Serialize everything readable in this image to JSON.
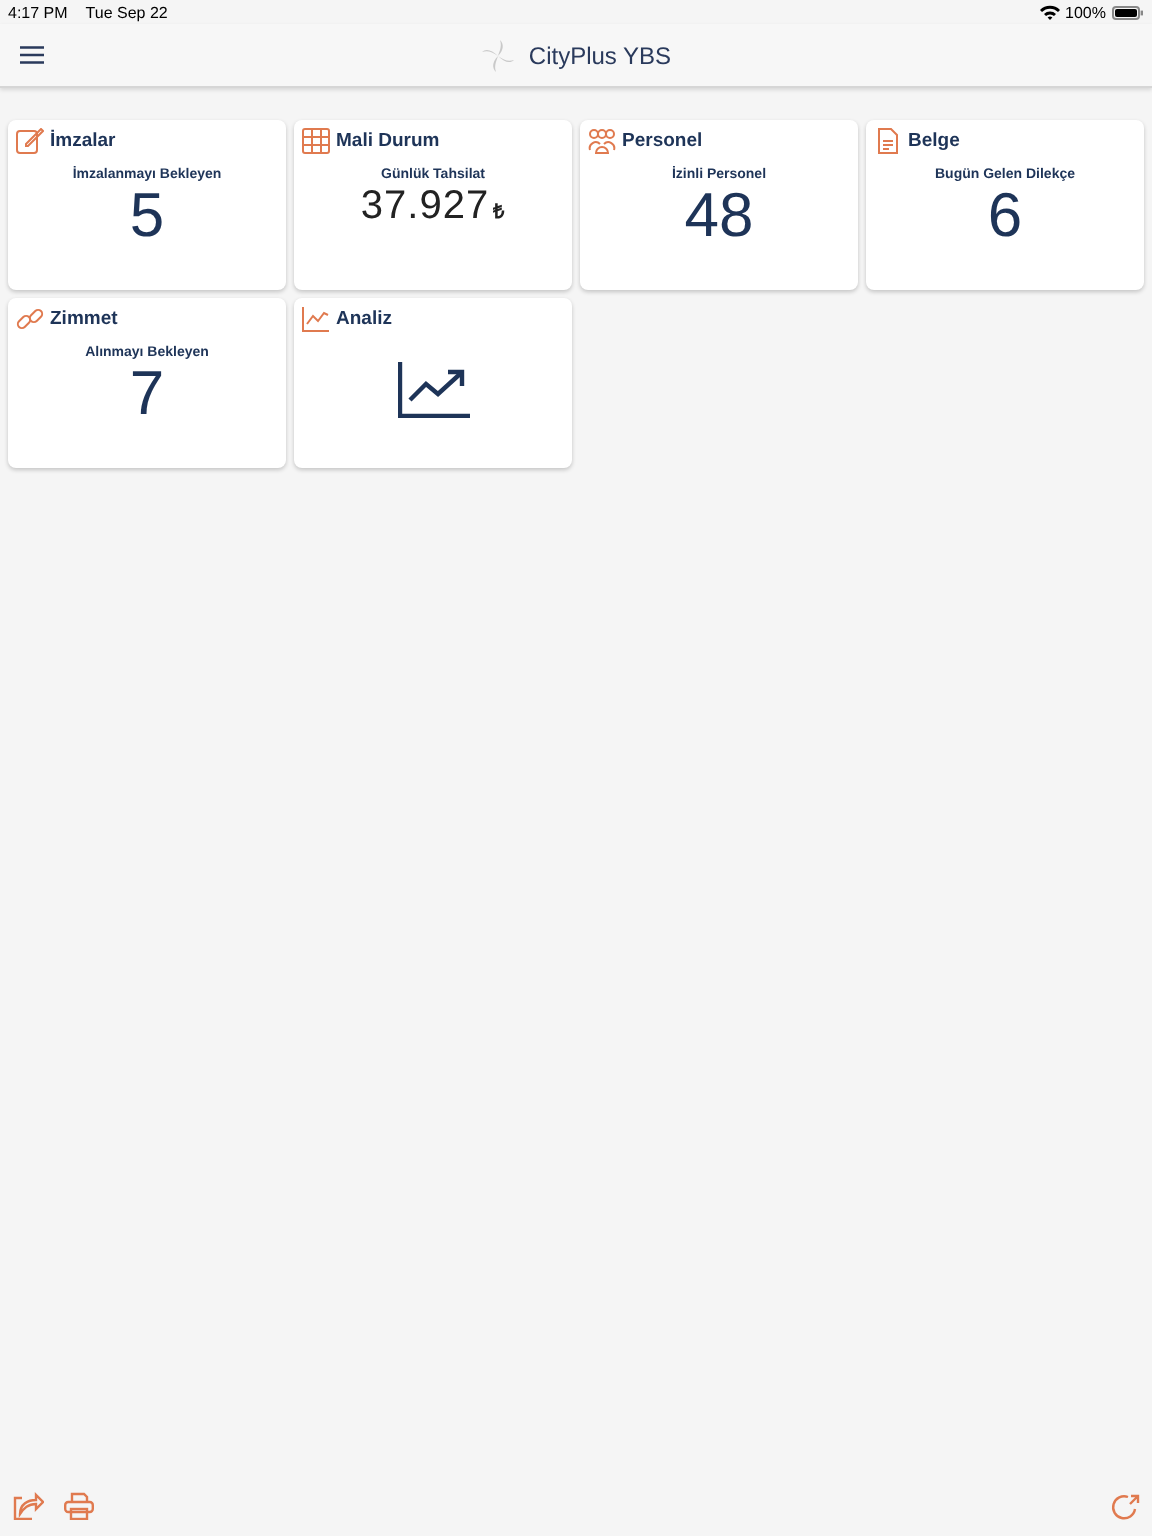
{
  "status_bar": {
    "time": "4:17 PM",
    "date": "Tue Sep 22",
    "battery": "100%"
  },
  "nav": {
    "title": "CityPlus YBS"
  },
  "cards": [
    {
      "kind": "stat",
      "title": "İmzalar",
      "label": "İmzalanmayı Bekleyen",
      "value": "5"
    },
    {
      "kind": "stat",
      "title": "Mali Durum",
      "label": "Günlük Tahsilat",
      "value": "37.927",
      "currency": "₺"
    },
    {
      "kind": "stat",
      "title": "Personel",
      "label": "İzinli Personel",
      "value": "48"
    },
    {
      "kind": "stat",
      "title": "Belge",
      "label": "Bugün Gelen Dilekçe",
      "value": "6"
    },
    {
      "kind": "stat",
      "title": "Zimmet",
      "label": "Alınmayı Bekleyen",
      "value": "7"
    },
    {
      "kind": "chart",
      "title": "Analiz"
    }
  ]
}
